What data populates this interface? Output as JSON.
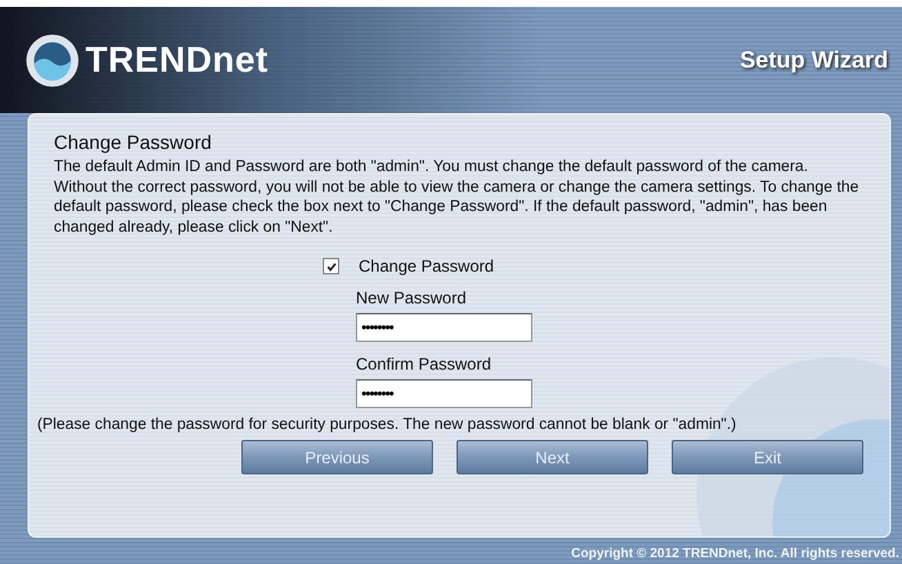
{
  "header": {
    "brand": "TRENDnet",
    "title": "Setup Wizard"
  },
  "panel": {
    "heading": "Change Password",
    "description": "The default Admin ID and Password are both \"admin\". You must change the default password of the camera. Without the correct password, you will not be able to view the camera or change the camera settings. To change the default password, please check the box next to \"Change Password\". If the default password, \"admin\", has been changed already, please click on \"Next\".",
    "change_password": {
      "label": "Change Password",
      "checked": true
    },
    "fields": [
      {
        "label": "New Password",
        "value": "••••••••"
      },
      {
        "label": "Confirm Password",
        "value": "••••••••"
      }
    ],
    "note": "(Please change the password for security purposes. The new password cannot be blank or \"admin\".)",
    "buttons": [
      "Previous",
      "Next",
      "Exit"
    ]
  },
  "footer": {
    "copyright": "Copyright © 2012 TRENDnet, Inc. All rights reserved."
  }
}
